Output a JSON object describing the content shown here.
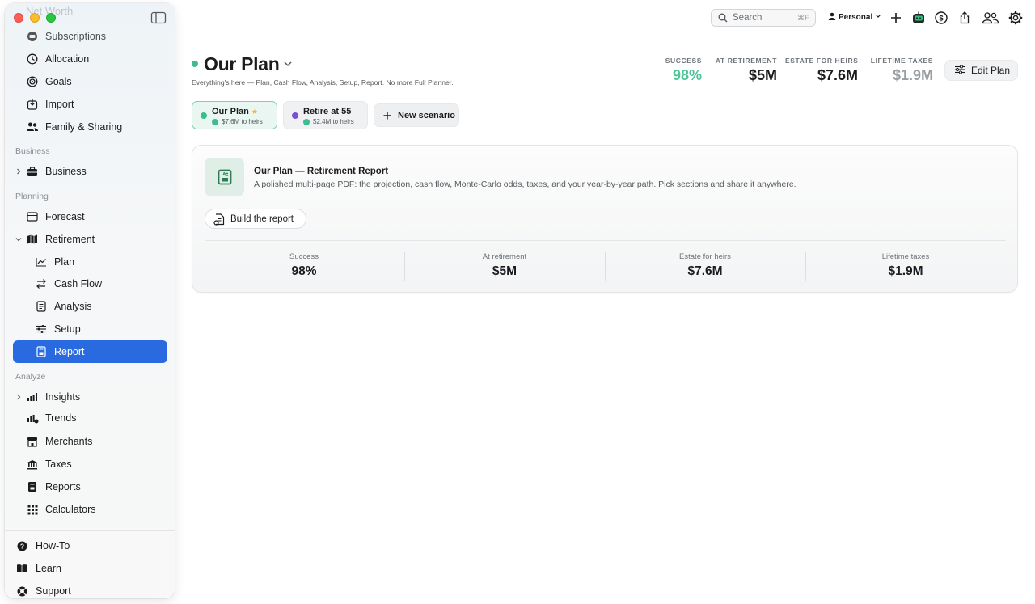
{
  "sidebar": {
    "ghost_item": "Net Worth",
    "items": [
      {
        "label": "Subscriptions"
      },
      {
        "label": "Allocation"
      },
      {
        "label": "Goals"
      },
      {
        "label": "Import"
      },
      {
        "label": "Family & Sharing"
      }
    ],
    "business_section": "Business",
    "business_item": "Business",
    "planning_section": "Planning",
    "planning_items": [
      {
        "label": "Forecast"
      },
      {
        "label": "Retirement"
      }
    ],
    "retirement_sub": [
      {
        "label": "Plan"
      },
      {
        "label": "Cash Flow"
      },
      {
        "label": "Analysis"
      },
      {
        "label": "Setup"
      },
      {
        "label": "Report"
      }
    ],
    "analyze_section": "Analyze",
    "analyze_items": [
      {
        "label": "Insights"
      },
      {
        "label": "Trends"
      },
      {
        "label": "Merchants"
      },
      {
        "label": "Taxes"
      },
      {
        "label": "Reports"
      },
      {
        "label": "Calculators"
      }
    ],
    "footer": [
      {
        "label": "How-To"
      },
      {
        "label": "Learn"
      },
      {
        "label": "Support"
      }
    ]
  },
  "toolbar": {
    "search_placeholder": "Search",
    "search_shortcut": "⌘F",
    "profile": "Personal"
  },
  "header": {
    "title": "Our Plan",
    "subtitle": "Everything's here — Plan, Cash Flow, Analysis, Setup, Report. No more Full Planner.",
    "kpis": [
      {
        "label": "SUCCESS",
        "value": "98%",
        "color": "#52c49a"
      },
      {
        "label": "AT RETIREMENT",
        "value": "$5M",
        "color": "#1c1c1e"
      },
      {
        "label": "ESTATE FOR HEIRS",
        "value": "$7.6M",
        "color": "#1c1c1e"
      },
      {
        "label": "LIFETIME TAXES",
        "value": "$1.9M",
        "color": "#9a9ea3"
      }
    ],
    "edit_button": "Edit Plan"
  },
  "scenarios": [
    {
      "name": "Our Plan",
      "meta": "$7.6M to heirs",
      "dot_color": "#3dbd8b"
    },
    {
      "name": "Retire at 55",
      "meta": "$2.4M to heirs",
      "dot_color": "#7a4fd6"
    }
  ],
  "new_scenario_label": "New scenario",
  "report_card": {
    "title": "Our Plan — Retirement Report",
    "description": "A polished multi-page PDF: the projection, cash flow, Monte-Carlo odds, taxes, and your year-by-year path. Pick sections and share it anywhere.",
    "build_button": "Build the report",
    "stats": [
      {
        "label": "Success",
        "value": "98%"
      },
      {
        "label": "At retirement",
        "value": "$5M"
      },
      {
        "label": "Estate for heirs",
        "value": "$7.6M"
      },
      {
        "label": "Lifetime taxes",
        "value": "$1.9M"
      }
    ]
  },
  "colors": {
    "accent_blue": "#2a6ae0",
    "success_green": "#3dbd8b",
    "scenario_purple": "#7a4fd6"
  }
}
